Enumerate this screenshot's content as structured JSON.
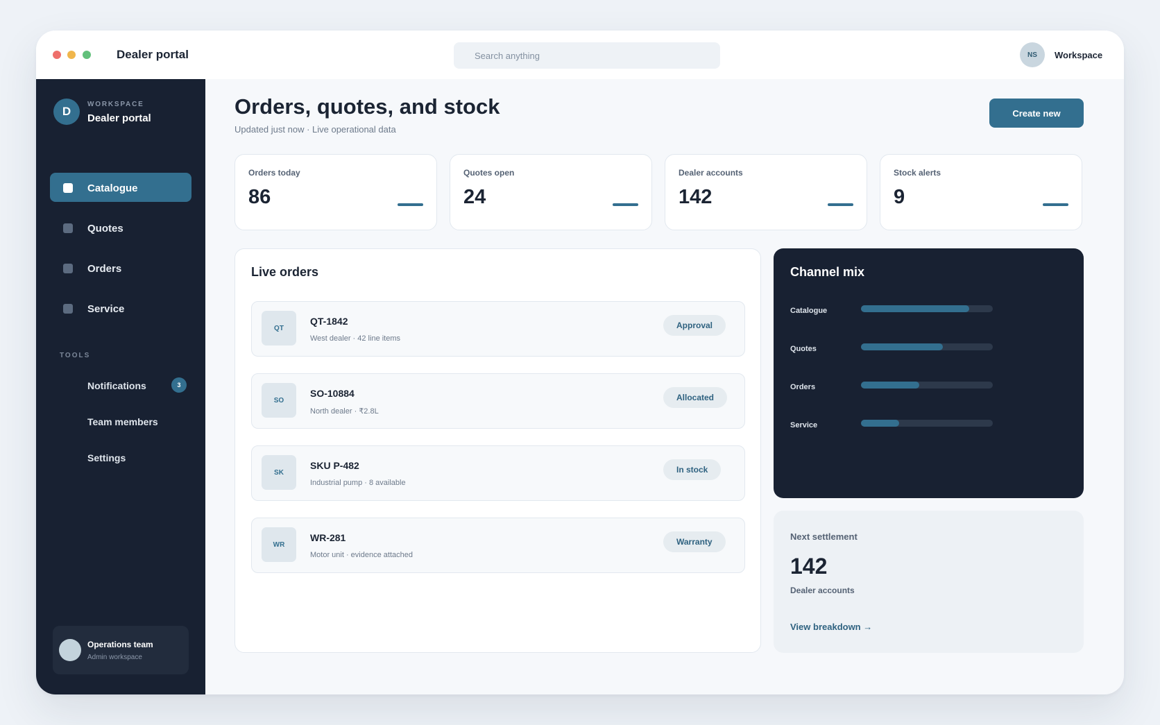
{
  "window": {
    "app_title": "Dealer portal",
    "search_placeholder": "Search anything",
    "user_initials": "NS",
    "user_label": "Workspace"
  },
  "sidebar": {
    "workspace_initial": "D",
    "workspace_kicker": "WORKSPACE",
    "workspace_name": "Dealer portal",
    "nav": [
      {
        "label": "Catalogue",
        "active": true
      },
      {
        "label": "Quotes",
        "active": false
      },
      {
        "label": "Orders",
        "active": false
      },
      {
        "label": "Service",
        "active": false
      }
    ],
    "tools_heading": "TOOLS",
    "tools": [
      {
        "label": "Notifications",
        "badge": "3"
      },
      {
        "label": "Team members"
      },
      {
        "label": "Settings"
      }
    ],
    "team": {
      "name": "Operations team",
      "sub": "Admin workspace"
    }
  },
  "header": {
    "title": "Orders, quotes, and stock",
    "subtitle": "Updated just now · Live operational data",
    "create_label": "Create new"
  },
  "stats": [
    {
      "label": "Orders today",
      "value": "86"
    },
    {
      "label": "Quotes open",
      "value": "24"
    },
    {
      "label": "Dealer accounts",
      "value": "142"
    },
    {
      "label": "Stock alerts",
      "value": "9"
    }
  ],
  "live_orders": {
    "title": "Live orders",
    "rows": [
      {
        "tile": "QT",
        "id": "QT-1842",
        "meta": "West dealer · 42 line items",
        "status": "Approval"
      },
      {
        "tile": "SO",
        "id": "SO-10884",
        "meta": "North dealer · ₹2.8L",
        "status": "Allocated"
      },
      {
        "tile": "SK",
        "id": "SKU P-482",
        "meta": "Industrial pump · 8 available",
        "status": "In stock"
      },
      {
        "tile": "WR",
        "id": "WR-281",
        "meta": "Motor unit · evidence attached",
        "status": "Warranty"
      }
    ]
  },
  "channel_mix": {
    "title": "Channel mix",
    "channels": [
      {
        "label": "Catalogue",
        "share": 0.82
      },
      {
        "label": "Quotes",
        "share": 0.62
      },
      {
        "label": "Orders",
        "share": 0.44
      },
      {
        "label": "Service",
        "share": 0.29
      }
    ]
  },
  "settlement": {
    "label": "Next settlement",
    "value": "142",
    "sub": "Dealer accounts",
    "link": "View breakdown →"
  },
  "colors": {
    "accent": "#336f8f",
    "sidebar": "#182132",
    "background": "#eef2f7"
  }
}
